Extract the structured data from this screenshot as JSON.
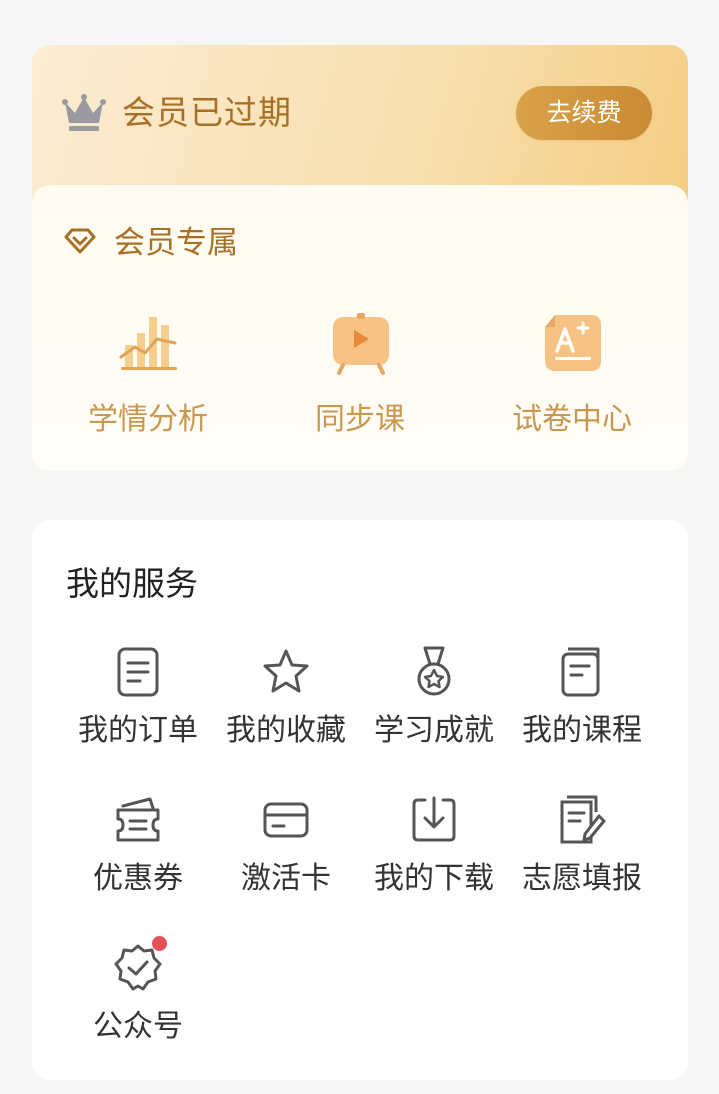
{
  "membership": {
    "status_label": "会员已过期",
    "renew_button_label": "去续费",
    "exclusive_title": "会员专属",
    "perks": [
      {
        "label": "学情分析",
        "icon": "bar-chart-icon"
      },
      {
        "label": "同步课",
        "icon": "video-lesson-icon"
      },
      {
        "label": "试卷中心",
        "icon": "exam-paper-icon"
      }
    ]
  },
  "services": {
    "title": "我的服务",
    "items": [
      {
        "label": "我的订单",
        "icon": "order-document-icon"
      },
      {
        "label": "我的收藏",
        "icon": "star-icon"
      },
      {
        "label": "学习成就",
        "icon": "medal-icon"
      },
      {
        "label": "我的课程",
        "icon": "course-book-icon"
      },
      {
        "label": "优惠券",
        "icon": "coupon-icon"
      },
      {
        "label": "激活卡",
        "icon": "card-icon"
      },
      {
        "label": "我的下载",
        "icon": "download-icon"
      },
      {
        "label": "志愿填报",
        "icon": "edit-document-icon"
      },
      {
        "label": "公众号",
        "icon": "verified-badge-icon",
        "has_notification": true
      }
    ]
  },
  "colors": {
    "gold_text": "#a87025",
    "perk_text": "#c9974e",
    "renew_button": "#d29a44",
    "icon_gray": "#555555",
    "notification_dot": "#e5505a"
  }
}
